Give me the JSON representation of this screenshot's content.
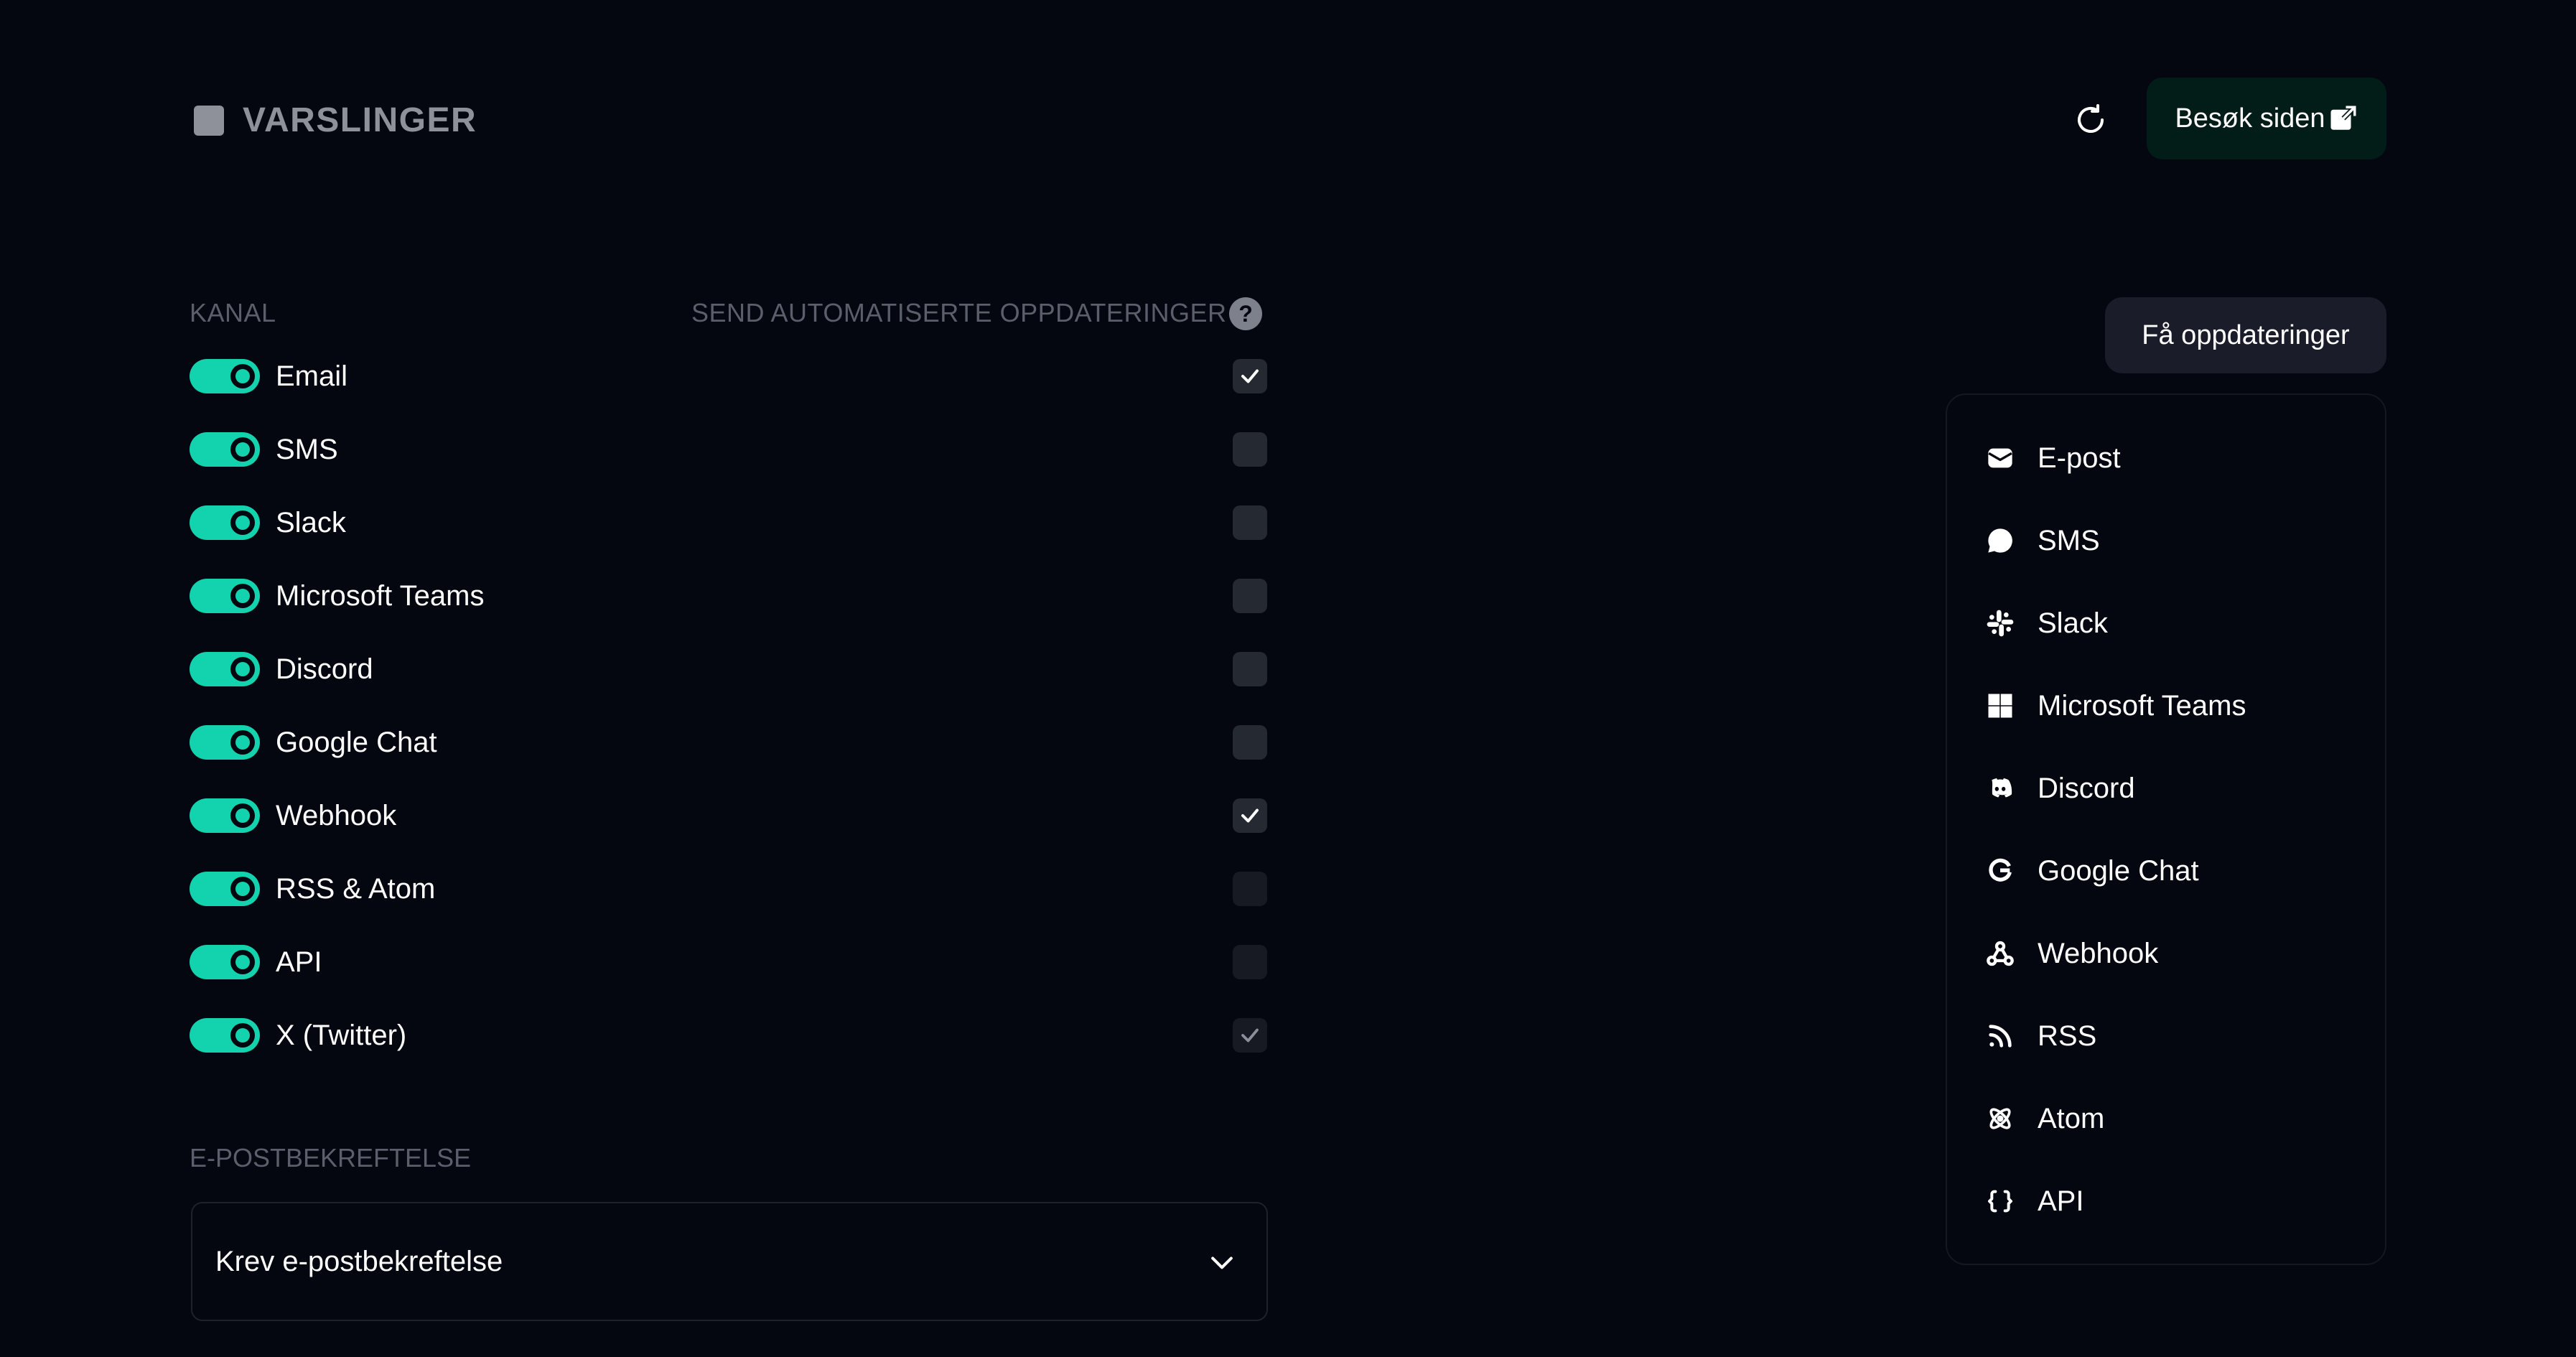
{
  "header": {
    "title": "VARSLINGER",
    "visit_label": "Besøk siden"
  },
  "columns": {
    "channel": "KANAL",
    "auto_updates": "SEND AUTOMATISERTE OPPDATERINGER",
    "help_glyph": "?"
  },
  "channels": [
    {
      "label": "Email",
      "enabled": true,
      "auto": true
    },
    {
      "label": "SMS",
      "enabled": true,
      "auto": false
    },
    {
      "label": "Slack",
      "enabled": true,
      "auto": false
    },
    {
      "label": "Microsoft Teams",
      "enabled": true,
      "auto": false
    },
    {
      "label": "Discord",
      "enabled": true,
      "auto": false
    },
    {
      "label": "Google Chat",
      "enabled": true,
      "auto": false
    },
    {
      "label": "Webhook",
      "enabled": true,
      "auto": true
    },
    {
      "label": "RSS & Atom",
      "enabled": true,
      "auto": false
    },
    {
      "label": "API",
      "enabled": true,
      "auto": false
    },
    {
      "label": "X (Twitter)",
      "enabled": true,
      "auto": true
    }
  ],
  "email_confirmation": {
    "heading": "E-POSTBEKREFTELSE",
    "selected": "Krev e-postbekreftelse"
  },
  "subscribe": {
    "button_label": "Få oppdateringer",
    "items": [
      {
        "label": "E-post",
        "icon": "envelope-icon"
      },
      {
        "label": "SMS",
        "icon": "chat-bubble-icon"
      },
      {
        "label": "Slack",
        "icon": "slack-icon"
      },
      {
        "label": "Microsoft Teams",
        "icon": "windows-icon"
      },
      {
        "label": "Discord",
        "icon": "discord-icon"
      },
      {
        "label": "Google Chat",
        "icon": "google-icon"
      },
      {
        "label": "Webhook",
        "icon": "webhook-icon"
      },
      {
        "label": "RSS",
        "icon": "rss-icon"
      },
      {
        "label": "Atom",
        "icon": "atom-icon"
      },
      {
        "label": "API",
        "icon": "braces-icon"
      }
    ]
  },
  "colors": {
    "accent": "#12d3ad",
    "background": "#040610",
    "muted_text": "#5a5f6b",
    "checkbox": "#252932"
  }
}
